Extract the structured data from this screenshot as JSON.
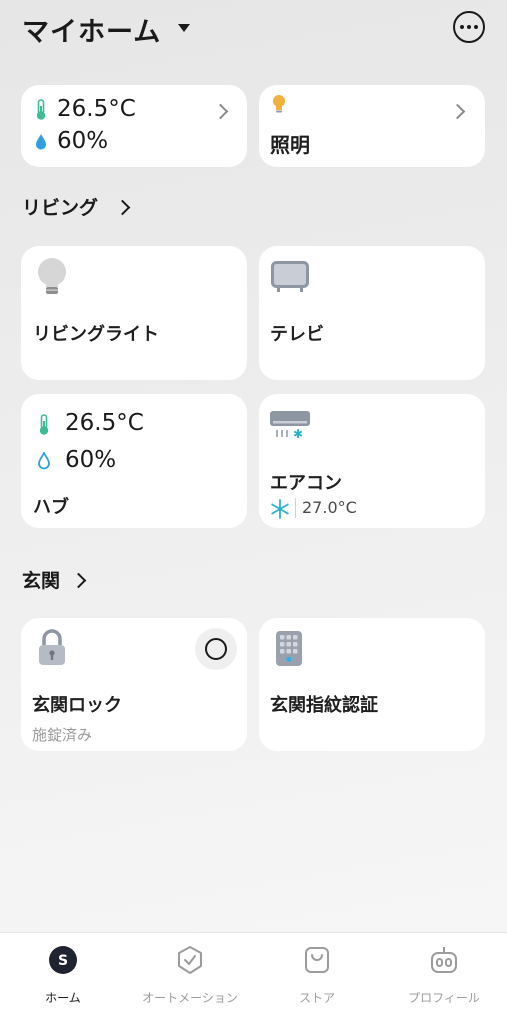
{
  "header": {
    "title": "マイホーム"
  },
  "summary": {
    "temperature": "26.5°C",
    "humidity": "60%",
    "lighting_label": "照明"
  },
  "rooms": [
    {
      "name": "リビング"
    },
    {
      "name": "玄関"
    }
  ],
  "devices": {
    "living_light": {
      "label": "リビングライト"
    },
    "tv": {
      "label": "テレビ"
    },
    "hub": {
      "label": "ハブ",
      "temperature": "26.5°C",
      "humidity": "60%"
    },
    "aircon": {
      "label": "エアコン",
      "set_temp": "27.0°C"
    },
    "lock": {
      "label": "玄関ロック",
      "status": "施錠済み"
    },
    "fingerprint": {
      "label": "玄関指紋認証"
    }
  },
  "tabs": [
    {
      "label": "ホーム",
      "active": true
    },
    {
      "label": "オートメーション"
    },
    {
      "label": "ストア"
    },
    {
      "label": "プロフィール"
    }
  ],
  "colors": {
    "thermo": "#3dbb95",
    "water": "#2f9fe0",
    "bulb": "#f2b13a",
    "snow": "#2bb4c8",
    "keypad_accent": "#2fb0e8"
  }
}
